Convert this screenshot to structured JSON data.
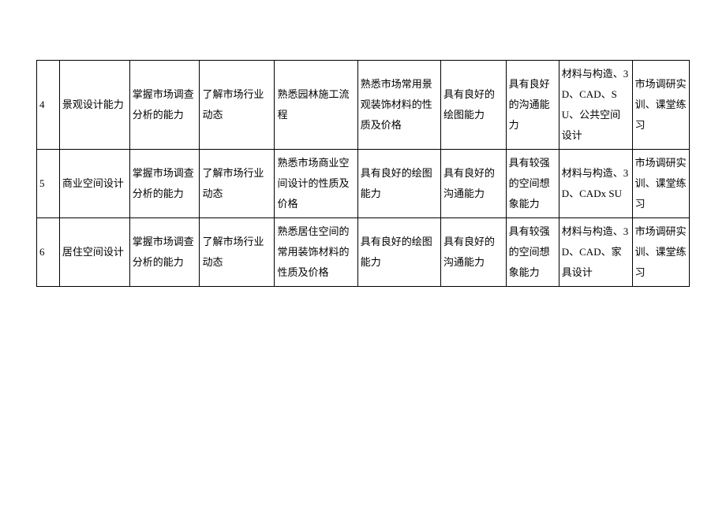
{
  "table": {
    "rows": [
      {
        "num": "4",
        "c1": "景观设计能力",
        "c2": "掌握市场调查分析的能力",
        "c3": "了解市场行业动态",
        "c4": "熟悉园林施工流程",
        "c5": "熟悉市场常用景观装饰材料的性质及价格",
        "c6": "具有良好的绘图能力",
        "c7": "具有良好的沟通能力",
        "c8": "材料与构造、3D、CAD、SU、公共空间设计",
        "c9": "市场调研实训、课堂练习"
      },
      {
        "num": "5",
        "c1": "商业空间设计",
        "c2": "掌握市场调查分析的能力",
        "c3": "了解市场行业动态",
        "c4": "熟悉市场商业空间设计的性质及价格",
        "c5": "具有良好的绘图能力",
        "c6": "具有良好的沟通能力",
        "c7": "具有较强的空间想象能力",
        "c8": "材料与构造、3D、CADx SU",
        "c9": "市场调研实训、课堂练习"
      },
      {
        "num": "6",
        "c1": "居住空间设计",
        "c2": "掌握市场调查分析的能力",
        "c3": "了解市场行业动态",
        "c4": "熟悉居住空间的常用装饰材料的性质及价格",
        "c5": "具有良好的绘图能力",
        "c6": "具有良好的沟通能力",
        "c7": "具有较强的空间想象能力",
        "c8": "材料与构造、3D、CAD、家具设计",
        "c9": "市场调研实训、课堂练习"
      }
    ]
  }
}
